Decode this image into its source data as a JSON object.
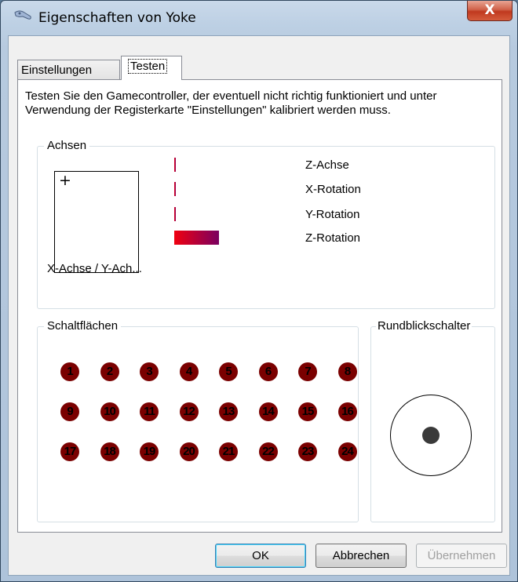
{
  "window": {
    "title": "Eigenschaften von Yoke",
    "close_label": "X"
  },
  "tabs": [
    {
      "label": "Einstellungen"
    },
    {
      "label": "Testen"
    }
  ],
  "description": "Testen Sie den Gamecontroller, der eventuell nicht richtig funktioniert und unter Verwendung der Registerkarte \"Einstellungen\" kalibriert werden muss.",
  "axes": {
    "label": "Achsen",
    "xy_label": "X-Achse / Y-Ach...",
    "crosshair": "+",
    "items": [
      {
        "label": "Z-Achse",
        "level": 0.0
      },
      {
        "label": "X-Rotation",
        "level": 0.0
      },
      {
        "label": "Y-Rotation",
        "level": 0.0
      },
      {
        "label": "Z-Rotation",
        "level": 0.1
      }
    ]
  },
  "buttons_group": {
    "label": "Schaltflächen",
    "buttons": [
      "1",
      "2",
      "3",
      "4",
      "5",
      "6",
      "7",
      "8",
      "9",
      "10",
      "11",
      "12",
      "13",
      "14",
      "15",
      "16",
      "17",
      "18",
      "19",
      "20",
      "21",
      "22",
      "23",
      "24"
    ]
  },
  "pov": {
    "label": "Rundblickschalter"
  },
  "actions": {
    "ok": "OK",
    "cancel": "Abbrechen",
    "apply": "Übernehmen"
  },
  "colors": {
    "button_indicator": "#7a0000",
    "axis_bar_start": "#f00010",
    "axis_bar_end": "#7a0060"
  }
}
